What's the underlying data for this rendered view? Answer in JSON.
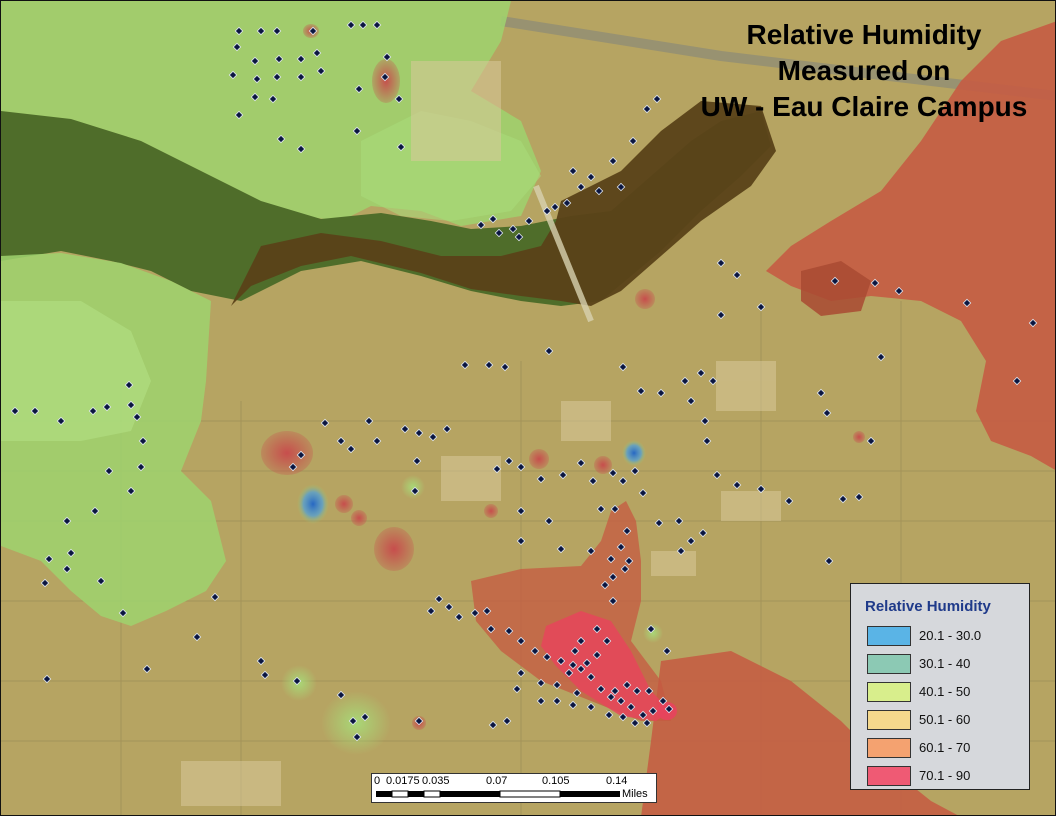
{
  "map": {
    "title_lines": [
      "Relative Humidity",
      "Measured on",
      "UW - Eau Claire Campus"
    ],
    "basemap": "aerial-imagery",
    "colors": {
      "river_green": "#4f6d2a",
      "river_brown": "#5a4218",
      "land_tan": "#b9a566",
      "green_zone": "#9fd36f",
      "red_zone": "#c65a42",
      "hot_pink": "#e8435d",
      "sample_point": "#0b1640"
    }
  },
  "legend": {
    "title": "Relative Humidity",
    "items": [
      {
        "label": "20.1 - 30.0",
        "color": "#5ab4e6"
      },
      {
        "label": "30.1 - 40",
        "color": "#8cc9b4"
      },
      {
        "label": "40.1 - 50",
        "color": "#d8ee8c"
      },
      {
        "label": "50.1 - 60",
        "color": "#f5d88c"
      },
      {
        "label": "60.1 - 70",
        "color": "#f4a270"
      },
      {
        "label": "70.1 - 90",
        "color": "#ef5a74"
      }
    ]
  },
  "scalebar": {
    "ticks": [
      "0",
      "0.0175",
      "0.035",
      "0.07",
      "0.105",
      "0.14"
    ],
    "units": "Miles"
  }
}
